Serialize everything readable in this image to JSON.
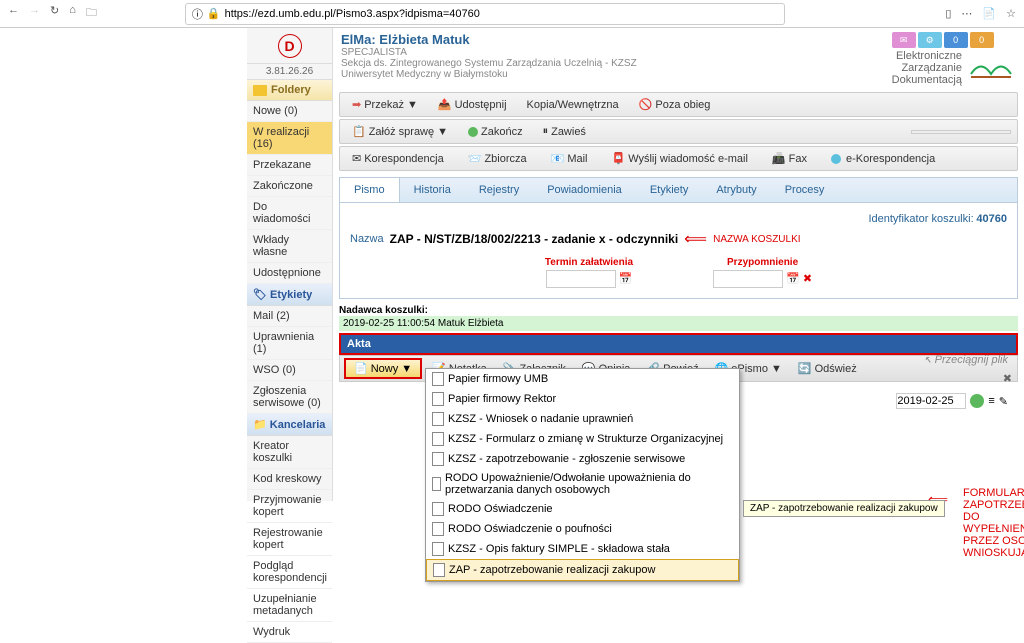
{
  "url": "https://ezd.umb.edu.pl/Pismo3.aspx?idpisma=40760",
  "version": "3.81.26.26",
  "user": {
    "name": "ElMa: Elżbieta Matuk",
    "role": "SPECJALISTA",
    "dept": "Sekcja ds. Zintegrowanego Systemu Zarządzania Uczelnią - KZSZ",
    "uni": "Uniwersytet Medyczny w Białymstoku"
  },
  "org": {
    "l1": "Elektroniczne",
    "l2": "Zarządzanie",
    "l3": "Dokumentacją"
  },
  "badges": {
    "b3": "0",
    "b4": "0"
  },
  "sidebar": {
    "foldery": "Foldery",
    "items": [
      "Nowe (0)",
      "W realizacji (16)",
      "Przekazane",
      "Zakończone",
      "Do wiadomości",
      "Wkłady własne",
      "Udostępnione"
    ],
    "etykiety": "Etykiety",
    "eitems": [
      "Mail (2)",
      "Uprawnienia (1)",
      "WSO (0)",
      "Zgłoszenia serwisowe (0)"
    ],
    "kancelaria": "Kancelaria",
    "kitems": [
      "Kreator koszulki",
      "Kod kreskowy",
      "Przyjmowanie kopert",
      "Rejestrowanie kopert",
      "Podgląd korespondencji",
      "Uzupełnianie metadanych",
      "Wydruk"
    ]
  },
  "tb1": {
    "przekaz": "Przekaż",
    "udostepnij": "Udostępnij",
    "kopia": "Kopia/Wewnętrzna",
    "poza": "Poza obieg"
  },
  "tb2": {
    "zaloz": "Załóż sprawę",
    "zakoncz": "Zakończ",
    "zawies": "Zawieś"
  },
  "tb3": {
    "kor": "Korespondencja",
    "zbi": "Zbiorcza",
    "mail": "Mail",
    "wys": "Wyślij wiadomość e-mail",
    "fax": "Fax",
    "ekor": "e-Korespondencja"
  },
  "tabs": [
    "Pismo",
    "Historia",
    "Rejestry",
    "Powiadomienia",
    "Etykiety",
    "Atrybuty",
    "Procesy"
  ],
  "doc": {
    "idlbl": "Identyfikator koszulki:",
    "id": "40760",
    "nazlbl": "Nazwa",
    "nazwa": "ZAP - N/ST/ZB/18/002/2213 - zadanie x - odczynniki",
    "note": "NAZWA KOSZULKI",
    "termin": "Termin załatwienia",
    "przyp": "Przypomnienie"
  },
  "nadawca": {
    "lbl": "Nadawca koszulki:",
    "val": "2019-02-25 11:00:54  Matuk Elżbieta"
  },
  "akta": {
    "hdr": "Akta",
    "nowy": "Nowy",
    "notatka": "Notatka",
    "zal": "Załącznik",
    "opinia": "Opinia",
    "powiez": "Powieź",
    "epismo": "ePismo",
    "odswiez": "Odśwież",
    "drag": "Przeciągnij plik"
  },
  "dropdown": [
    "Papier firmowy UMB",
    "Papier firmowy Rektor",
    "KZSZ - Wniosek o nadanie uprawnień",
    "KZSZ - Formularz o zmianę w Strukturze Organizacyjnej",
    "KZSZ - zapotrzebowanie - zgłoszenie serwisowe",
    "RODO Upoważnienie/Odwołanie upoważnienia do przetwarzania danych osobowych",
    "RODO Oświadczenie",
    "RODO Oświadczenie o poufności",
    "KZSZ - Opis faktury SIMPLE - składowa stała",
    "ZAP - zapotrzebowanie realizacji zakupow"
  ],
  "tooltip": "ZAP - zapotrzebowanie realizacji zakupow",
  "rednote": {
    "l1": "FORMULARZ ZAPOTRZEBOWANIA DO",
    "l2": "WYPEŁNIENIA PRZEZ OSOBĘ WNIOSKUJĄCĄ"
  },
  "date": "2019-02-25"
}
